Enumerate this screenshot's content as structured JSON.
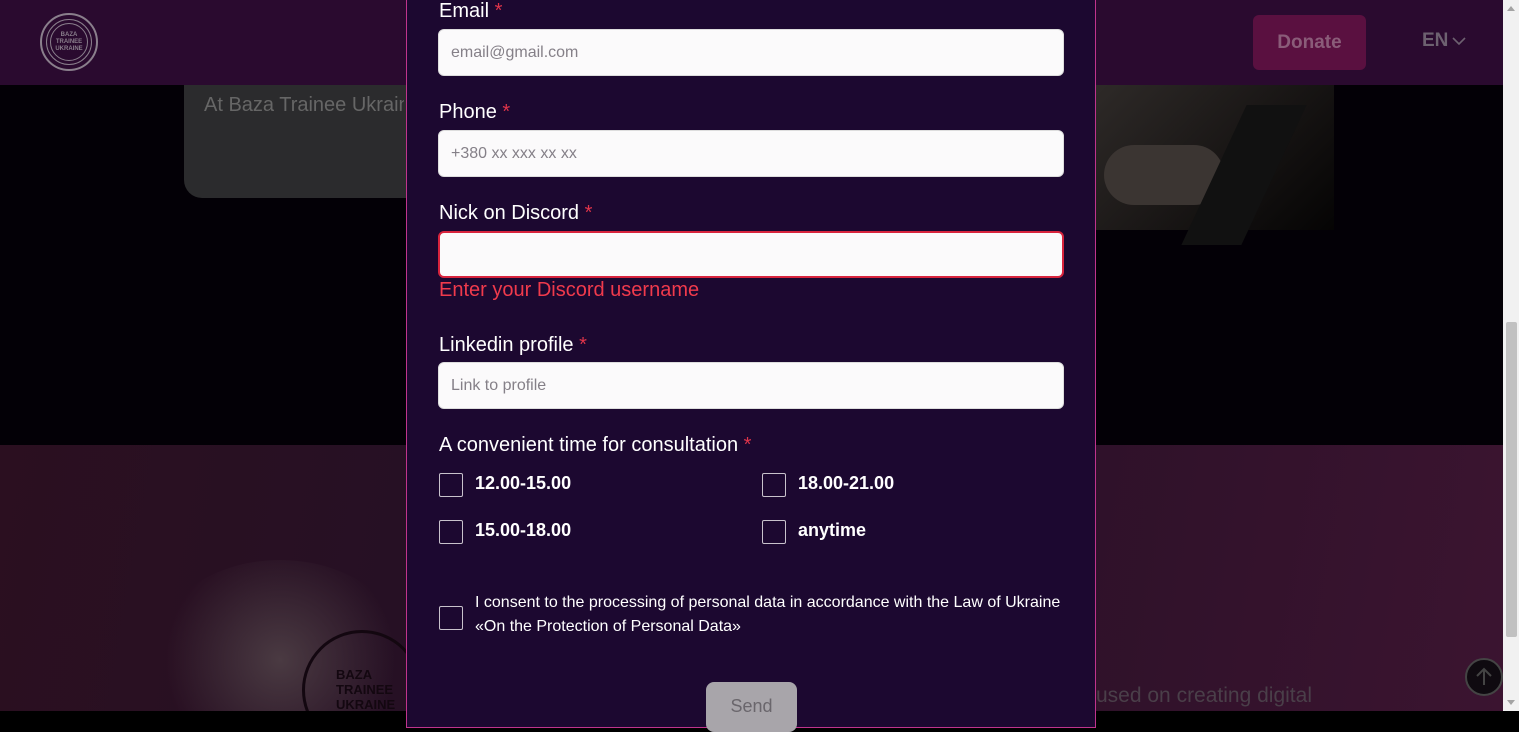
{
  "background": {
    "logo_text": [
      "BAZA",
      "TRAINEE",
      "UKRAINE"
    ],
    "donate_label": "Donate",
    "language": "EN",
    "card_text": "At Baza Trainee Ukraine several people at one professional develop",
    "tagline": "used on creating digital"
  },
  "form": {
    "email": {
      "label": "Email",
      "required_mark": "*",
      "placeholder": "email@gmail.com",
      "value": ""
    },
    "phone": {
      "label": "Phone",
      "required_mark": "*",
      "placeholder": "+380 xx xxx xx xx",
      "value": ""
    },
    "discord": {
      "label": "Nick on Discord",
      "required_mark": "*",
      "value": "",
      "error": "Enter your Discord username"
    },
    "linkedin": {
      "label": "Linkedin profile",
      "required_mark": "*",
      "placeholder": "Link to profile",
      "value": ""
    },
    "time": {
      "label": "A convenient time for consultation",
      "required_mark": "*",
      "options": [
        "12.00-15.00",
        "18.00-21.00",
        "15.00-18.00",
        "anytime"
      ]
    },
    "consent": "I consent to the processing of personal data in accordance with the Law of Ukraine «On the Protection of Personal Data»",
    "send_label": "Send"
  },
  "colors": {
    "modal_bg": "#1c0830",
    "accent_border": "#c0348d",
    "error": "#f03a4c",
    "donate_bg": "#5a1040"
  },
  "icons": {
    "language_dropdown": "chevron-down-icon",
    "scroll_top": "arrow-up-icon"
  }
}
